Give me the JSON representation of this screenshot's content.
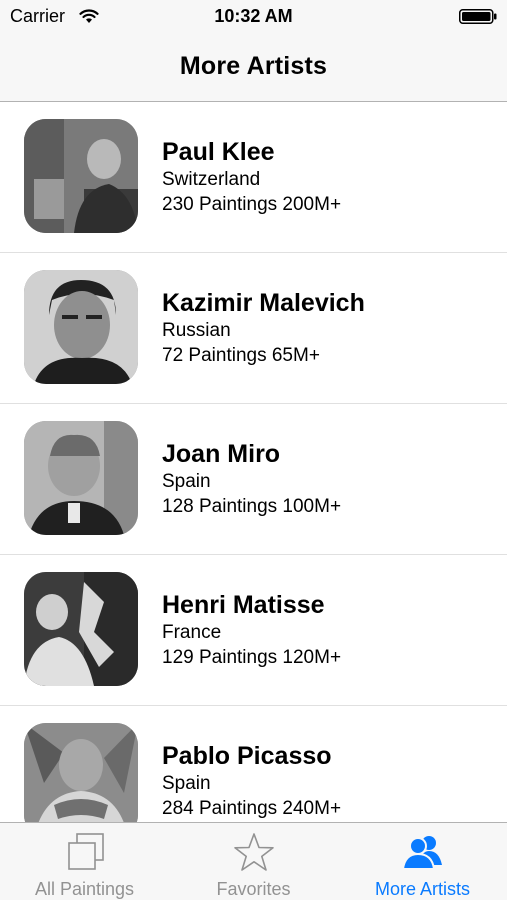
{
  "status_bar": {
    "carrier": "Carrier",
    "time": "10:32 AM",
    "wifi_icon": "wifi-icon",
    "battery_icon": "battery-icon"
  },
  "nav": {
    "title": "More Artists"
  },
  "artists": [
    {
      "name": "Paul Klee",
      "country": "Switzerland",
      "stats": "230 Paintings 200M+",
      "photo": "portrait-photo"
    },
    {
      "name": "Kazimir Malevich",
      "country": "Russian",
      "stats": "72 Paintings 65M+",
      "photo": "portrait-photo"
    },
    {
      "name": "Joan Miro",
      "country": "Spain",
      "stats": "128 Paintings 100M+",
      "photo": "portrait-photo"
    },
    {
      "name": "Henri Matisse",
      "country": "France",
      "stats": "129 Paintings 120M+",
      "photo": "portrait-photo"
    },
    {
      "name": "Pablo Picasso",
      "country": "Spain",
      "stats": "284 Paintings 240M+",
      "photo": "portrait-photo"
    }
  ],
  "tabs": [
    {
      "label": "All Paintings",
      "icon": "paintings-icon",
      "active": false
    },
    {
      "label": "Favorites",
      "icon": "star-icon",
      "active": false
    },
    {
      "label": "More Artists",
      "icon": "people-icon",
      "active": true
    }
  ],
  "colors": {
    "accent": "#0a7bff",
    "inactive": "#929292",
    "bar_background": "#f7f7f7"
  }
}
